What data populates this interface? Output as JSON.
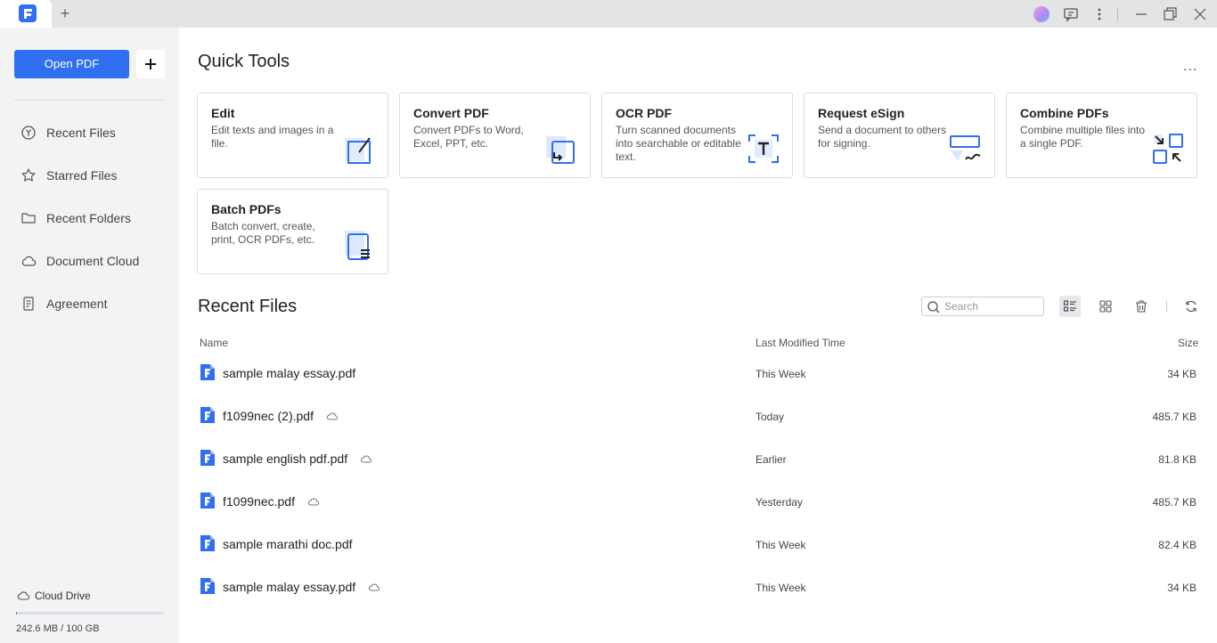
{
  "titlebar": {
    "new_tab_label": "+"
  },
  "sidebar": {
    "open_pdf_label": "Open PDF",
    "add_label": "+",
    "items": [
      {
        "label": "Recent Files",
        "icon": "clock-icon"
      },
      {
        "label": "Starred Files",
        "icon": "star-icon"
      },
      {
        "label": "Recent Folders",
        "icon": "folder-icon"
      },
      {
        "label": "Document Cloud",
        "icon": "cloud-icon"
      },
      {
        "label": "Agreement",
        "icon": "document-icon"
      }
    ],
    "cloud_drive_label": "Cloud Drive",
    "storage_text": "242.6 MB / 100 GB",
    "storage_used_fraction": 0.0024
  },
  "quick_tools": {
    "title": "Quick Tools",
    "more_label": "...",
    "cards": [
      {
        "title": "Edit",
        "desc": "Edit texts and images in a file.",
        "icon": "edit-icon"
      },
      {
        "title": "Convert PDF",
        "desc": "Convert PDFs to Word, Excel, PPT, etc.",
        "icon": "convert-icon"
      },
      {
        "title": "OCR PDF",
        "desc": "Turn scanned documents into searchable or editable text.",
        "icon": "ocr-icon"
      },
      {
        "title": "Request eSign",
        "desc": "Send a document to others for signing.",
        "icon": "esign-icon"
      },
      {
        "title": "Combine PDFs",
        "desc": "Combine multiple files into a single PDF.",
        "icon": "combine-icon"
      },
      {
        "title": "Batch PDFs",
        "desc": "Batch convert, create, print, OCR PDFs, etc.",
        "icon": "batch-icon"
      }
    ]
  },
  "recent": {
    "title": "Recent Files",
    "search_placeholder": "Search",
    "columns": {
      "name": "Name",
      "modified": "Last Modified Time",
      "size": "Size"
    },
    "files": [
      {
        "name": "sample malay essay.pdf",
        "modified": "This Week",
        "size": "34 KB",
        "cloud": false
      },
      {
        "name": "f1099nec (2).pdf",
        "modified": "Today",
        "size": "485.7 KB",
        "cloud": true
      },
      {
        "name": "sample english pdf.pdf",
        "modified": "Earlier",
        "size": "81.8 KB",
        "cloud": true
      },
      {
        "name": "f1099nec.pdf",
        "modified": "Yesterday",
        "size": "485.7 KB",
        "cloud": true
      },
      {
        "name": "sample marathi doc.pdf",
        "modified": "This Week",
        "size": "82.4 KB",
        "cloud": false
      },
      {
        "name": "sample malay essay.pdf",
        "modified": "This Week",
        "size": "34 KB",
        "cloud": true
      }
    ]
  },
  "colors": {
    "accent": "#2f6ff0",
    "sidebar_bg": "#f2f3f5",
    "titlebar_bg": "#e3e4e6"
  }
}
